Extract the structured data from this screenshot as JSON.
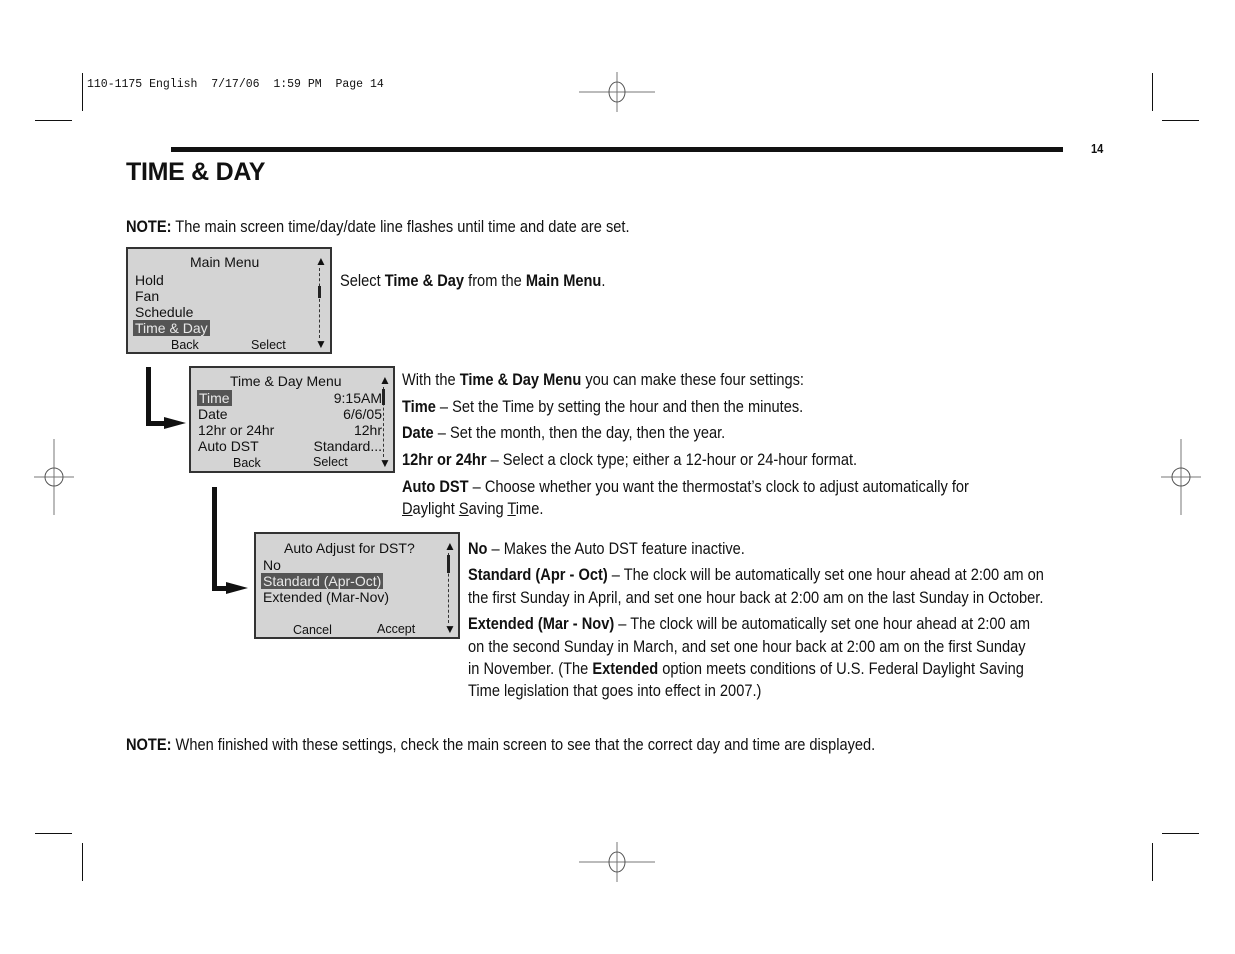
{
  "print_slug": "110-1175 English  7/17/06  1:59 PM  Page 14",
  "page_number": "14",
  "title": "TIME & DAY",
  "note_top": {
    "label": "NOTE:",
    "text": " The main screen time/day/date line flashes until time and date are set."
  },
  "step1": {
    "pre": "Select ",
    "b1": "Time & Day",
    "mid": " from the ",
    "b2": "Main Menu",
    "post": "."
  },
  "main_menu": {
    "title": "Main Menu",
    "items": [
      "Hold",
      "Fan",
      "Schedule",
      "Time & Day"
    ],
    "selected": "Time & Day",
    "soft_left": "Back",
    "soft_right": "Select"
  },
  "time_day_menu": {
    "title": "Time & Day Menu",
    "rows": [
      {
        "label": "Time",
        "value": "9:15AM"
      },
      {
        "label": "Date",
        "value": "6/6/05"
      },
      {
        "label": "12hr or 24hr",
        "value": "12hr"
      },
      {
        "label": "Auto DST",
        "value": "Standard..."
      }
    ],
    "selected": "Time",
    "soft_left": "Back",
    "soft_right": "Select"
  },
  "dst_menu": {
    "title": "Auto Adjust for DST?",
    "items": [
      "No",
      "Standard (Apr-Oct)",
      "Extended (Mar-Nov)"
    ],
    "selected": "Standard (Apr-Oct)",
    "soft_left": "Cancel",
    "soft_right": "Accept"
  },
  "settings_intro": {
    "pre": "With the ",
    "b": "Time & Day Menu",
    "post": " you can make these four settings:"
  },
  "settings": [
    {
      "term": "Time",
      "desc": " – Set the Time by setting the hour and then the minutes."
    },
    {
      "term": "Date",
      "desc": " – Set the month, then the day, then the year."
    },
    {
      "term": "12hr or 24hr",
      "desc": " – Select a clock type; either a 12-hour or 24-hour format."
    },
    {
      "term": "Auto DST",
      "desc": " – Choose whether you want the thermostat’s clock to adjust automatically for"
    }
  ],
  "auto_dst_line2": {
    "d": "D",
    "aylight": "aylight ",
    "s": "S",
    "aving": "aving ",
    "t": "T",
    "ime": "ime."
  },
  "dst_options": {
    "no": {
      "term": "No",
      "desc": " – Makes the Auto DST feature inactive."
    },
    "standard": {
      "term": "Standard (Apr - Oct)",
      "line1": " – The clock will be automatically set one hour ahead at 2:00 am on",
      "line2": "the first Sunday in April, and set one hour back at 2:00 am on the last Sunday in October."
    },
    "extended": {
      "term": "Extended (Mar - Nov)",
      "line1": " – The clock will be automatically set one hour ahead at 2:00 am",
      "line2": "on the second Sunday in March, and set one hour back at 2:00 am on the first Sunday",
      "line3_pre": "in November. (The ",
      "line3_b": "Extended",
      "line3_post": " option meets conditions of U.S. Federal Daylight Saving",
      "line4": "Time legislation that goes into effect in 2007.)"
    }
  },
  "note_bottom": {
    "label": "NOTE:",
    "text": " When finished with these settings, check the main screen to see that the correct day and time are displayed."
  }
}
